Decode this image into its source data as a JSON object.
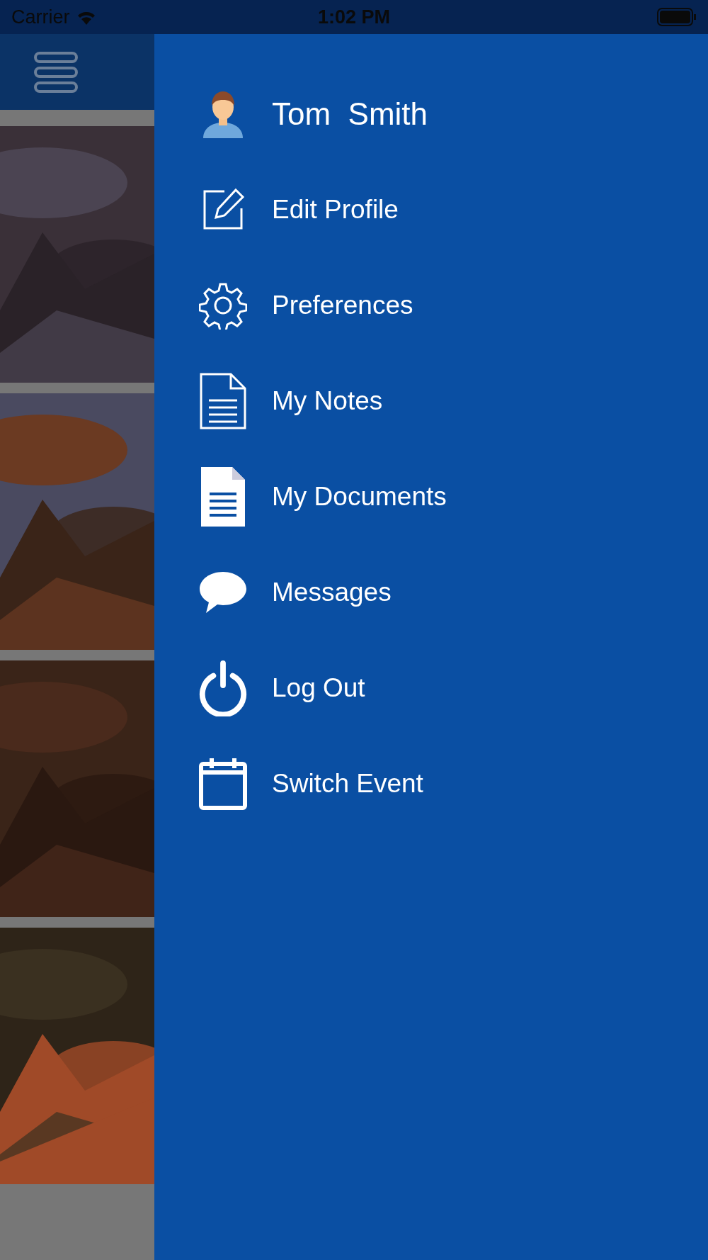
{
  "status_bar": {
    "carrier": "Carrier",
    "time": "1:02 PM"
  },
  "menu": {
    "user": {
      "name": "Tom  Smith"
    },
    "items": [
      {
        "label": "Edit Profile",
        "kind": "edit"
      },
      {
        "label": "Preferences",
        "kind": "gear"
      },
      {
        "label": "My Notes",
        "kind": "note"
      },
      {
        "label": "My Documents",
        "kind": "document"
      },
      {
        "label": "Messages",
        "kind": "chat"
      },
      {
        "label": "Log Out",
        "kind": "power"
      },
      {
        "label": "Switch Event",
        "kind": "calendar"
      }
    ]
  }
}
